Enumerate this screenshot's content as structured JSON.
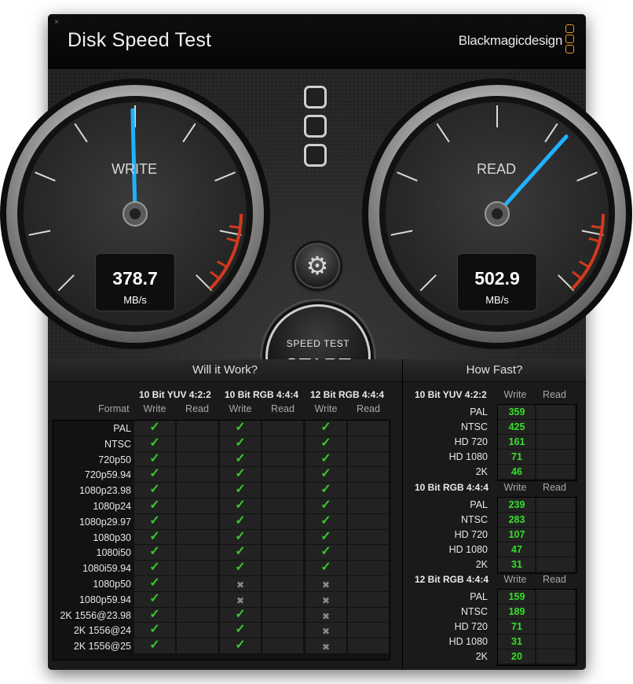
{
  "window": {
    "title": "Disk Speed Test",
    "brand": "Blackmagicdesign",
    "close_glyph": "×"
  },
  "gauges": {
    "write": {
      "label": "WRITE",
      "value": "378.7",
      "unit": "MB/s",
      "needle_fraction": 0.495
    },
    "read": {
      "label": "READ",
      "value": "502.9",
      "unit": "MB/s",
      "needle_fraction": 0.655
    }
  },
  "controls": {
    "settings_icon": "gear-icon",
    "start_small": "SPEED TEST",
    "start_big": "START"
  },
  "will_it_work": {
    "title": "Will it Work?",
    "format_header": "Format",
    "groups": [
      "10 Bit YUV 4:2:2",
      "10 Bit RGB 4:4:4",
      "12 Bit RGB 4:4:4"
    ],
    "write_label": "Write",
    "read_label": "Read",
    "ok_glyph": "✓",
    "fail_glyph": "✖",
    "rows": [
      {
        "format": "PAL",
        "w": [
          true,
          true,
          true
        ]
      },
      {
        "format": "NTSC",
        "w": [
          true,
          true,
          true
        ]
      },
      {
        "format": "720p50",
        "w": [
          true,
          true,
          true
        ]
      },
      {
        "format": "720p59.94",
        "w": [
          true,
          true,
          true
        ]
      },
      {
        "format": "1080p23.98",
        "w": [
          true,
          true,
          true
        ]
      },
      {
        "format": "1080p24",
        "w": [
          true,
          true,
          true
        ]
      },
      {
        "format": "1080p29.97",
        "w": [
          true,
          true,
          true
        ]
      },
      {
        "format": "1080p30",
        "w": [
          true,
          true,
          true
        ]
      },
      {
        "format": "1080i50",
        "w": [
          true,
          true,
          true
        ]
      },
      {
        "format": "1080i59.94",
        "w": [
          true,
          true,
          true
        ]
      },
      {
        "format": "1080p50",
        "w": [
          true,
          false,
          false
        ]
      },
      {
        "format": "1080p59.94",
        "w": [
          true,
          false,
          false
        ]
      },
      {
        "format": "2K 1556@23.98",
        "w": [
          true,
          true,
          false
        ]
      },
      {
        "format": "2K 1556@24",
        "w": [
          true,
          true,
          false
        ]
      },
      {
        "format": "2K 1556@25",
        "w": [
          true,
          true,
          false
        ]
      }
    ]
  },
  "how_fast": {
    "title": "How Fast?",
    "write_label": "Write",
    "read_label": "Read",
    "groups": [
      {
        "name": "10 Bit YUV 4:2:2",
        "rows": [
          {
            "format": "PAL",
            "write": "359"
          },
          {
            "format": "NTSC",
            "write": "425"
          },
          {
            "format": "HD 720",
            "write": "161"
          },
          {
            "format": "HD 1080",
            "write": "71"
          },
          {
            "format": "2K",
            "write": "46"
          }
        ]
      },
      {
        "name": "10 Bit RGB 4:4:4",
        "rows": [
          {
            "format": "PAL",
            "write": "239"
          },
          {
            "format": "NTSC",
            "write": "283"
          },
          {
            "format": "HD 720",
            "write": "107"
          },
          {
            "format": "HD 1080",
            "write": "47"
          },
          {
            "format": "2K",
            "write": "31"
          }
        ]
      },
      {
        "name": "12 Bit RGB 4:4:4",
        "rows": [
          {
            "format": "PAL",
            "write": "159"
          },
          {
            "format": "NTSC",
            "write": "189"
          },
          {
            "format": "HD 720",
            "write": "71"
          },
          {
            "format": "HD 1080",
            "write": "31"
          },
          {
            "format": "2K",
            "write": "20"
          }
        ]
      }
    ]
  },
  "colors": {
    "needle": "#1fb2ff",
    "ok": "#39c82a",
    "speed_value": "#35e02a",
    "redline": "#d23a1c",
    "brand_logo": "#e89a2a"
  }
}
